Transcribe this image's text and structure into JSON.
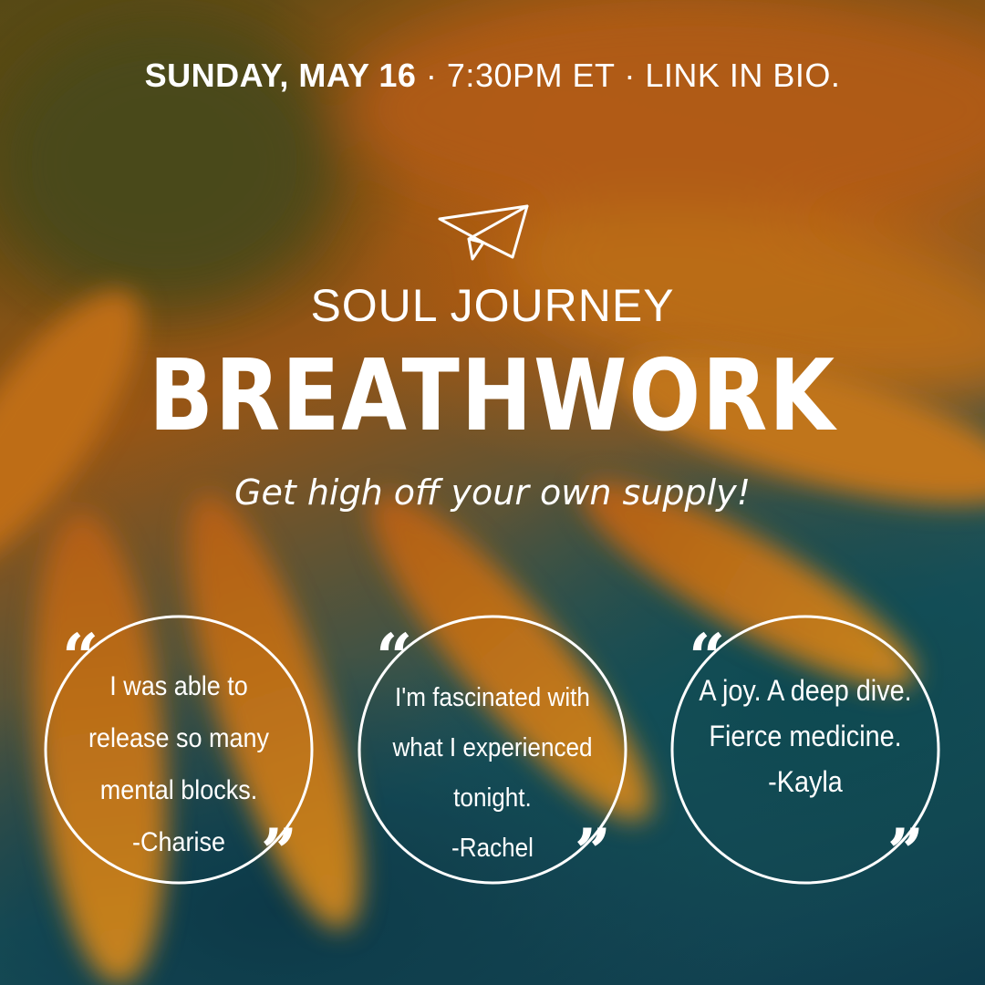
{
  "header": {
    "date": "SUNDAY, MAY 16",
    "details": " · 7:30PM ET · LINK IN BIO."
  },
  "hero": {
    "plane_icon": "paper-plane-icon",
    "subtitle": "SOUL JOURNEY",
    "title": "BREATHWORK",
    "tagline": "Get high off your own supply!"
  },
  "testimonials": [
    {
      "lines": [
        "I was able to",
        "release so many",
        "mental blocks.",
        "-Charise"
      ]
    },
    {
      "lines": [
        "I'm fascinated with",
        "what I experienced",
        "tonight.",
        "-Rachel"
      ]
    },
    {
      "lines": [
        "A joy. A deep dive.",
        "Fierce medicine.",
        "-Kayla"
      ]
    }
  ],
  "quote_marks": {
    "open": "“",
    "close": "”"
  },
  "colors": {
    "text": "#ffffff",
    "orange": "#e8871c",
    "teal": "#1a5e6c"
  }
}
